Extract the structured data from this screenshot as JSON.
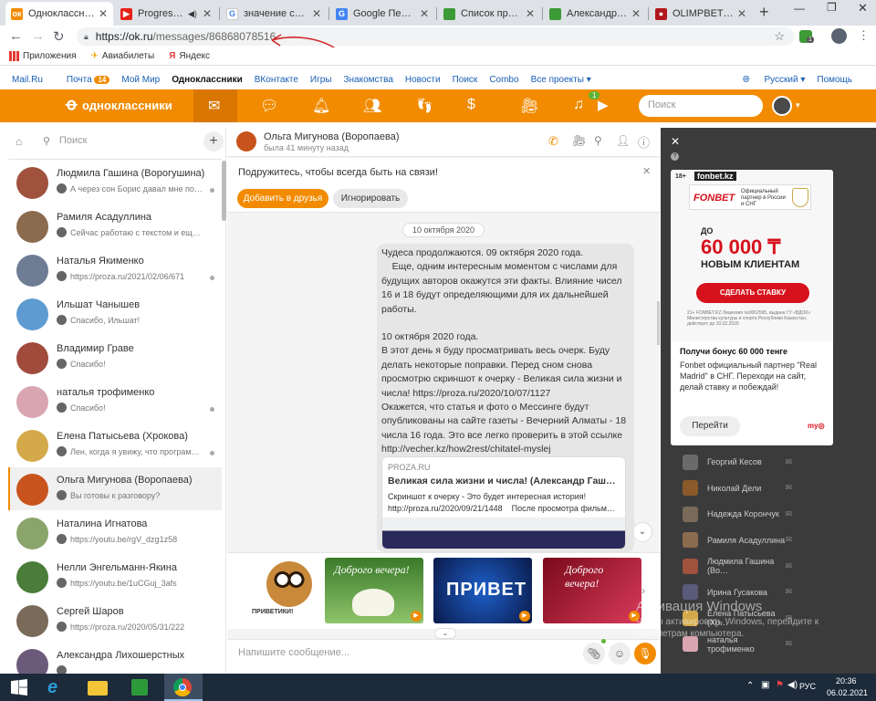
{
  "browser": {
    "tabs": [
      {
        "title": "Одноклассники",
        "favicon_color": "#f28b00",
        "active": true
      },
      {
        "title": "Progressive T",
        "favicon_color": "#e62117",
        "active": false
      },
      {
        "title": "значение слова",
        "favicon_color": "#4285f4",
        "active": false
      },
      {
        "title": "Google Перевод",
        "favicon_color": "#4285f4",
        "active": false
      },
      {
        "title": "Список прочтен",
        "favicon_color": "#3c9a37",
        "active": false
      },
      {
        "title": "Александр Гашн",
        "favicon_color": "#3c9a37",
        "active": false
      },
      {
        "title": "OLIMPBET - Спо",
        "favicon_color": "#b1181e",
        "active": false
      }
    ],
    "new_tab": "+",
    "url_host": "https://ok.ru",
    "url_path": "/messages/86868078516",
    "bookmarks": [
      {
        "label": "Приложения",
        "icon": "apps-icon"
      },
      {
        "label": "Авиабилеты",
        "icon": "plane-icon"
      },
      {
        "label": "Яндекс",
        "icon": "yandex-icon"
      }
    ],
    "ext_badge": "1"
  },
  "portal": {
    "links": [
      "Mail.Ru",
      "Почта",
      "Мой Мир",
      "Одноклассники",
      "ВКонтакте",
      "Игры",
      "Знакомства",
      "Новости",
      "Поиск",
      "Combo",
      "Все проекты ▾"
    ],
    "mail_badge": "14",
    "lang": "Русский ▾",
    "help": "Помощь"
  },
  "ok_header": {
    "logo": "одноклассники",
    "music_badge": "1",
    "search_placeholder": "Поиск"
  },
  "chats": {
    "search_placeholder": "Поиск",
    "list": [
      {
        "name": "Людмила Гашина (Ворогушина)",
        "preview": "А через сон Борис давал мне по…",
        "color": "#a0523d"
      },
      {
        "name": "Рамиля Асадуллина",
        "preview": "Сейчас работаю с текстом и ещ…",
        "color": "#8b6b4e"
      },
      {
        "name": "Наталья Якименко",
        "preview": "https://proza.ru/2021/02/06/671",
        "color": "#6e7c94"
      },
      {
        "name": "Ильшат Чанышев",
        "preview": "Спасибо, Ильшат!",
        "color": "#5d9bd1"
      },
      {
        "name": "Владимир Граве",
        "preview": "Спасибо!",
        "color": "#a04b3c"
      },
      {
        "name": "наталья трофименко",
        "preview": "Спасибо!",
        "color": "#d9a5b0"
      },
      {
        "name": "Елена Патысьева (Хрокова)",
        "preview": "Лен, когда я увижу, что програм…",
        "color": "#d4a94a"
      },
      {
        "name": "Ольга Мигунова (Воропаева)",
        "preview": "Вы готовы к разговору?",
        "color": "#c8531c"
      },
      {
        "name": "Наталина Игнатова",
        "preview": "https://youtu.be/rgV_dzg1z58",
        "color": "#8aa46b"
      },
      {
        "name": "Нелли Энгельманн-Якина",
        "preview": "https://youtu.be/1uCGuj_3afs",
        "color": "#4b7d3a"
      },
      {
        "name": "Сергей Шаров",
        "preview": "https://proza.ru/2020/05/31/222",
        "color": "#7a6a5a"
      },
      {
        "name": "Александра Лихошерстных",
        "preview": "",
        "color": "#6b5a7a"
      }
    ]
  },
  "conversation": {
    "contact_name": "Ольга Мигунова (Воропаева)",
    "last_seen": "была 41 минуту назад",
    "friend_prompt": "Подружитесь, чтобы всегда быть на связи!",
    "add_friend": "Добавить в друзья",
    "ignore": "Игнорировать",
    "date_chip": "10 октября 2020",
    "message_lines": [
      "Чудеса продолжаются. 09 октября 2020 года.",
      "    Еще, одним интересным моментом с числами для",
      "будущих авторов окажутся эти факты. Влияние чисел",
      "16 и 18 будут определяющими для их дальнейшей",
      "работы.",
      "",
      "10 октября 2020 года.",
      "В этот день я буду просматривать весь очерк. Буду",
      "делать некоторые поправки. Перед сном снова",
      "просмотрю скриншот к очерку - Великая сила жизни и",
      "числа! https://proza.ru/2020/10/07/1127",
      "Окажется, что статья и фото о Мессинге будут",
      "опубликованы на сайте газеты - Вечерний Алматы - 18",
      "числа 16 года. Это все легко проверить в этой ссылке",
      "http://vecher.kz/how2rest/chitatel-myslej"
    ],
    "link_card": {
      "site": "PROZA.RU",
      "title": "Великая сила жизни и числа! (Александр Гаш…",
      "desc": "Скриншот к очерку - Это будет интересная история!",
      "url": "http://proza.ru/2020/09/21/1448    После просмотра фильм…"
    },
    "stickers": [
      "ПРИВЕТИКИ!",
      "Доброго вечера!",
      "ПРИВЕТ",
      "Доброго вечера!"
    ],
    "input_placeholder": "Напишите сообщение..."
  },
  "ad": {
    "brand_domain": "fonbet.kz",
    "age": "18+",
    "brand": "FONBET",
    "partner_text": "Официальный партнер в России и СНГ",
    "pre_text": "ДО",
    "amount": "60 000 ₸",
    "clients": "НОВЫМ КЛИЕНТАМ",
    "cta": "СДЕЛАТЬ СТАВКУ",
    "headline": "Получи бонус 60 000 тенге",
    "body": "Fonbet официальный партнер \"Real Madrid\" в СНГ. Переходи на сайт, делай ставку и побеждай!",
    "go": "Перейти",
    "fine_print": "21+ FONBET.KZ Лицензия №0002595, выдана ГУ «ВДОК» Министерства культуры и спорта Республики Казахстан, действует до 10.02.2029"
  },
  "right_friends": [
    "Георгий Кесов",
    "Николай Дели",
    "Надежда Корончук",
    "Рамиля Асадуллина",
    "Людмила Гашина (Во…",
    "Ирина Гусакова",
    "Елена Патысьева (Хр…",
    "наталья трофименко"
  ],
  "watermark": {
    "title": "Активация Windows",
    "subtitle": "Чтобы активировать Windows, перейдите к параметрам компьютера."
  },
  "taskbar": {
    "lang": "РУС",
    "time": "20:36",
    "date": "06.02.2021"
  }
}
